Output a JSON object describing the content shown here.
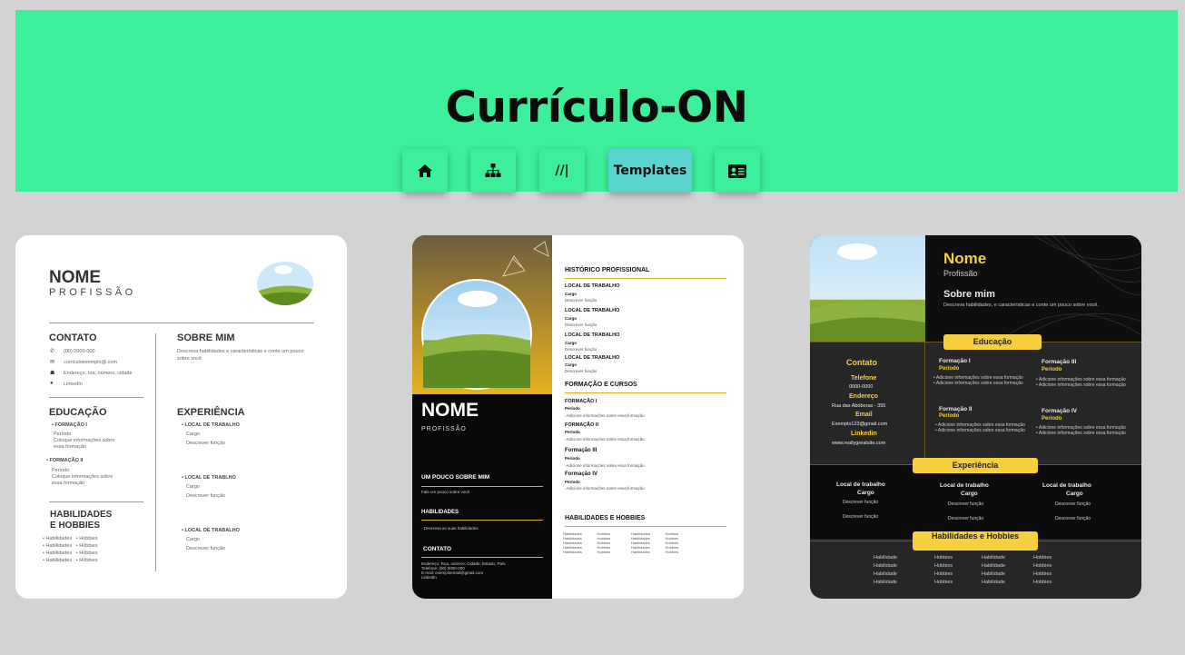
{
  "header": {
    "title": "Currículo-ON",
    "nav": [
      {
        "icon": "home-icon"
      },
      {
        "icon": "sitemap-icon"
      },
      {
        "label": "//|"
      },
      {
        "label": "Templates"
      },
      {
        "icon": "id-card-icon"
      }
    ]
  },
  "template1": {
    "name": "NOME",
    "profession": "PROFISSÃO",
    "contact_title": "CONTATO",
    "contact": [
      "(00) 0000-000",
      "curriculoexemplo@.com",
      "Endereço, rua, número, cidade",
      "LinkedIn"
    ],
    "about_title": "SOBRE MIM",
    "about_text": "Descreva habilidades e características e conte um pouco sobre você",
    "education_title": "EDUCAÇÃO",
    "education": [
      {
        "title": "FORMAÇÃO I",
        "period": "Período",
        "desc": "Coloque informações sobre",
        "desc2": "essa formação"
      },
      {
        "title": "FORMAÇÃO II",
        "period": "Período",
        "desc": "Coloque informações sobre",
        "desc2": "essa formação"
      }
    ],
    "experience_title": "EXPERIÊNCIA",
    "experience": [
      {
        "place": "LOCAL DE TRABALHO",
        "role": "Cargo",
        "desc": "Descrever função"
      },
      {
        "place": "LOCAL DE TRABLHO",
        "role": "Cargo",
        "desc": "Descrever função"
      },
      {
        "place": "LOCAL DE TRABALHO",
        "role": "Cargo",
        "desc": "Descrever função"
      }
    ],
    "skills_title": "HABILIDADES",
    "skills_title2": "E HOBBIES",
    "skills": [
      "Habilidades",
      "Hobbies"
    ]
  },
  "template2": {
    "name": "NOME",
    "profession": "PROFISSÃO",
    "about_title": "UM POUCO SOBRE MIM",
    "about_text": "Fale um pouco sobre você",
    "skills_title": "HABILIDADES",
    "skills_text": "- Descreva as suas habilidades",
    "contact_title": "CONTATO",
    "contact_text": [
      "Endereço: Rua, número, Cidade, Estado, País",
      "Telefone: (00) 0000-000",
      "E-mail: exemploemail@gmail.com",
      "Linkedin"
    ],
    "history_title": "HISTÓRICO PROFISSIONAL",
    "jobs": [
      "LOCAL DE TRABALHO",
      "LOCAL DE TRABALHO",
      "LOCAL DE TRABALHO",
      "LOCAL DE TRABALHO"
    ],
    "job_role": "Cargo",
    "job_desc": "Descrever função",
    "education_title": "FORMAÇÃO E CURSOS",
    "courses": [
      "FORMAÇÃO I",
      "FORMAÇÃO II",
      "Formação III",
      "Formação IV"
    ],
    "course_period": "Período",
    "course_desc": "-Adicione informações sobre essa formação",
    "hobbies_title": "HABILIDADES E HOBBIES",
    "hobby_a": "Habilidades",
    "hobby_b": "Hobbies"
  },
  "template3": {
    "name": "Nome",
    "profession": "Profissão",
    "about_title": "Sobre mim",
    "about_text": "Descreva habilidades, e características e conte um pouco sobre você.",
    "education_pill": "Educação",
    "contact_title": "Contato",
    "phone_label": "Telefone",
    "phone": "0000-0000",
    "address_label": "Endereço",
    "address": "Rua das Abóboras - 355",
    "email_label": "Email",
    "email": "Exemplo123@gmail.com",
    "linkedin_label": "Linkedin",
    "linkedin": "www.reallygreatsite.com",
    "formations": [
      "Formação I",
      "Formação III",
      "Formação II",
      "Formação IV"
    ],
    "formation_period": "Período",
    "formation_desc": "Adicione informações sobre essa formação",
    "experience_pill": "Experiência",
    "job_place": "Local de trabalho",
    "job_role": "Cargo",
    "job_desc": "Descrever função",
    "skills_pill": "Habilidades e Hobbies",
    "skill": "Habilidade",
    "hobby": "Hobbies"
  },
  "colors": {
    "accent": "#3def9a",
    "active_tab": "#5bd3cf",
    "background": "#d3d3d3",
    "yellow": "#f5cf3d"
  }
}
